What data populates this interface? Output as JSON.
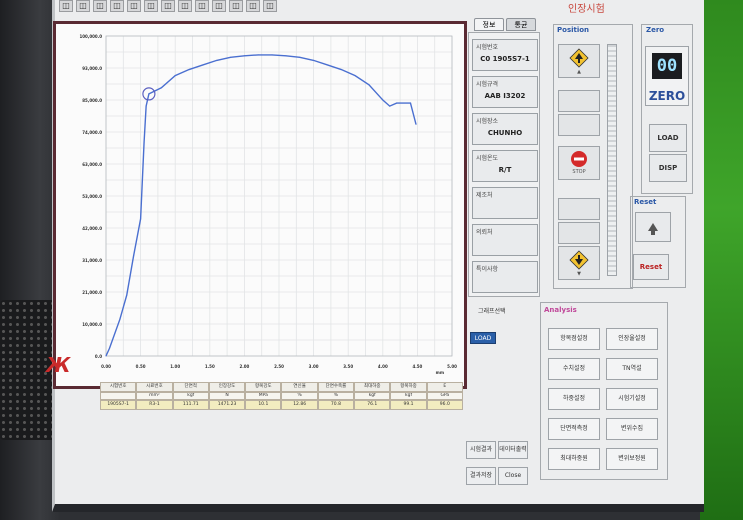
{
  "window": {
    "title": "인장시험"
  },
  "toolbar": {
    "buttons": [
      "◫",
      "◫",
      "◫",
      "◫",
      "◫",
      "◫",
      "◫",
      "◫",
      "◫",
      "◫",
      "◫",
      "◫",
      "◫"
    ]
  },
  "tabs": [
    {
      "label": "정보",
      "active": true
    },
    {
      "label": "통균",
      "active": false
    }
  ],
  "info": [
    {
      "label": "시험번호",
      "value": "C0 1905S7-1"
    },
    {
      "label": "시험규격",
      "value": "AAB I3202"
    },
    {
      "label": "시험장소",
      "value": "CHUNHO"
    },
    {
      "label": "시험온도",
      "value": "R/T"
    },
    {
      "label": "제조처",
      "value": ""
    },
    {
      "label": "의뢰처",
      "value": ""
    },
    {
      "label": "특이사항",
      "value": ""
    }
  ],
  "graph_select": {
    "label": "그래프선택",
    "value": "LOAD"
  },
  "position": {
    "title": "Position",
    "buttons": [
      {
        "label": "▲",
        "icon": "up-arrow-icon"
      },
      {
        "label": "",
        "icon": ""
      },
      {
        "label": "",
        "icon": ""
      },
      {
        "label": "STOP",
        "icon": "stop-icon"
      },
      {
        "label": "",
        "icon": ""
      },
      {
        "label": "",
        "icon": ""
      },
      {
        "label": "▼",
        "icon": "down-arrow-icon"
      }
    ]
  },
  "zero": {
    "title": "Zero",
    "display": "00",
    "label": "ZERO",
    "load": "LOAD",
    "disp": "DISP"
  },
  "reset": {
    "title": "Reset",
    "reset_all": "Reset"
  },
  "analysis": {
    "title": "Analysis",
    "buttons": [
      "항복점설정",
      "인장율설정",
      "수치설정",
      "TN역설",
      "하중설정",
      "시험기설정",
      "단면적측정",
      "변위수집",
      "최대하중원",
      "변위보정원"
    ]
  },
  "bottom_buttons": [
    "시험결과",
    "데이터출력",
    "결과저장",
    "Close"
  ],
  "results": {
    "headers": [
      "시험번호",
      "시료번호",
      "단면적",
      "인장강도",
      "항복강도",
      "연신율",
      "단면수축률",
      "최대하중",
      "항복하중",
      "E"
    ],
    "units": [
      "",
      "mm²",
      "kgf",
      "N",
      "MPa",
      "%",
      "%",
      "kgf",
      "kgf",
      "GPa"
    ],
    "row": [
      "1905S7-1",
      "R3-1",
      "111.71",
      "1471.23",
      "10.1",
      "12.86",
      "70.8",
      "76.1",
      "99.1",
      "96.0"
    ]
  },
  "chart_data": {
    "type": "line",
    "title": "",
    "xlabel": "mm",
    "ylabel": "",
    "y_ticks": [
      "100,000.0",
      "93,000.0",
      "85,000.0",
      "74,000.0",
      "63,000.0",
      "53,000.0",
      "42,000.0",
      "31,000.0",
      "21,000.0",
      "10,000.0",
      "0.0"
    ],
    "x_ticks": [
      "0.00",
      "0.50",
      "1.00",
      "1.50",
      "2.00",
      "2.50",
      "3.00",
      "3.50",
      "4.00",
      "4.50",
      "5.00"
    ],
    "ylim": [
      0,
      105000
    ],
    "xlim": [
      0,
      5.0
    ],
    "series": [
      {
        "color": "#4a6fd0",
        "x": [
          0.0,
          0.05,
          0.2,
          0.3,
          0.4,
          0.5,
          0.55,
          0.58,
          0.62,
          0.8,
          1.0,
          1.2,
          1.4,
          1.6,
          1.8,
          2.0,
          2.2,
          2.4,
          2.6,
          2.8,
          3.0,
          3.2,
          3.4,
          3.6,
          3.8,
          4.0,
          4.1,
          4.2,
          4.4,
          4.48
        ],
        "y": [
          0,
          2500,
          12000,
          20000,
          33000,
          45000,
          70000,
          82000,
          86000,
          88000,
          92000,
          94000,
          95500,
          97000,
          98000,
          98500,
          98800,
          98800,
          98500,
          98000,
          97000,
          95500,
          94000,
          92000,
          89000,
          84000,
          82000,
          83000,
          83000,
          76000
        ]
      }
    ],
    "marker": {
      "x": 0.62,
      "y": 86000
    }
  }
}
